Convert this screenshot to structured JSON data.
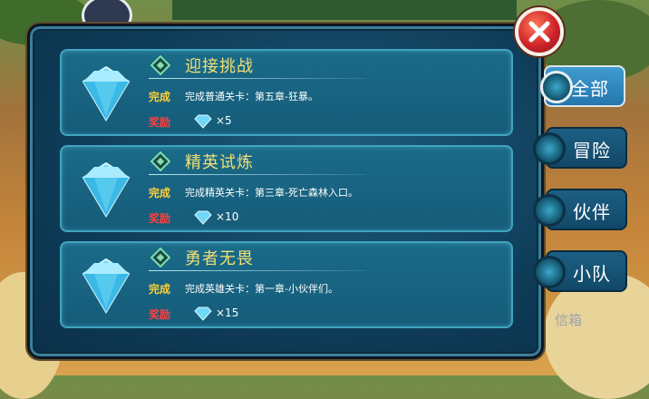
{
  "close_icon": "close-x-icon",
  "tabs": [
    {
      "label": "全部",
      "active": true
    },
    {
      "label": "冒险",
      "active": false
    },
    {
      "label": "伙伴",
      "active": false
    },
    {
      "label": "小队",
      "active": false
    }
  ],
  "mailbox_label": "信箱",
  "achievements": [
    {
      "title": "迎接挑战",
      "done_label": "完成",
      "description": "完成普通关卡：第五章-狂暴。",
      "reward_label": "奖励",
      "reward_quantity": "×5"
    },
    {
      "title": "精英试炼",
      "done_label": "完成",
      "description": "完成精英关卡：第三章-死亡森林入口。",
      "reward_label": "奖励",
      "reward_quantity": "×10"
    },
    {
      "title": "勇者无畏",
      "done_label": "完成",
      "description": "完成英雄关卡：第一章-小伙伴们。",
      "reward_label": "奖励",
      "reward_quantity": "×15"
    }
  ],
  "colors": {
    "title": "#f3df76",
    "done": "#ffce3a",
    "reward": "#ff3f3f",
    "gem": "#5fd3f5"
  }
}
